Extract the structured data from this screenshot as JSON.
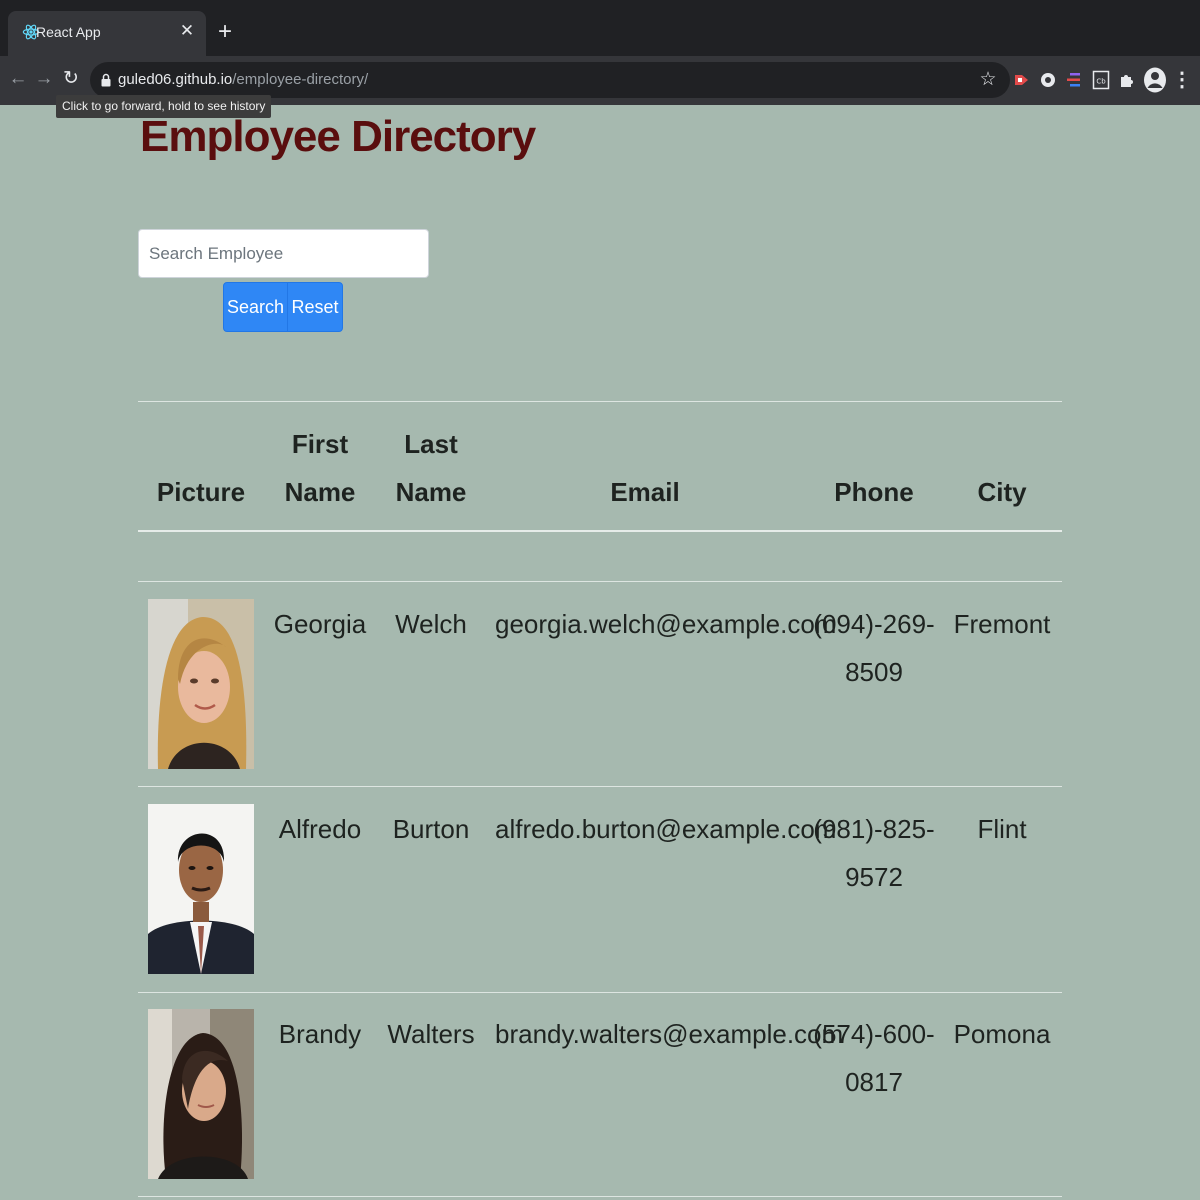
{
  "browser": {
    "tab_title": "React App",
    "url_host": "guled06.github.io",
    "url_path": "/employee-directory/",
    "tooltip": "Click to go forward, hold to see history"
  },
  "page": {
    "title": "Employee Directory",
    "search_placeholder": "Search Employee",
    "search_button": "Search",
    "reset_button": "Reset"
  },
  "table": {
    "headers": {
      "picture": "Picture",
      "first_name_1": "First",
      "first_name_2": "Name",
      "last_name_1": "Last",
      "last_name_2": "Name",
      "email": "Email",
      "phone": "Phone",
      "city": "City"
    },
    "rows": [
      {
        "first": "Georgia",
        "last": "Welch",
        "email": "georgia.welch@example.com",
        "phone_1": "(094)-269-",
        "phone_2": "8509",
        "city": "Fremont"
      },
      {
        "first": "Alfredo",
        "last": "Burton",
        "email": "alfredo.burton@example.com",
        "phone_1": "(981)-825-",
        "phone_2": "9572",
        "city": "Flint"
      },
      {
        "first": "Brandy",
        "last": "Walters",
        "email": "brandy.walters@example.com",
        "phone_1": "(574)-600-",
        "phone_2": "0817",
        "city": "Pomona"
      }
    ]
  },
  "colors": {
    "page_background": "#a6b9af",
    "title_color": "#5a0e0e",
    "button_blue": "#2f87f5"
  }
}
